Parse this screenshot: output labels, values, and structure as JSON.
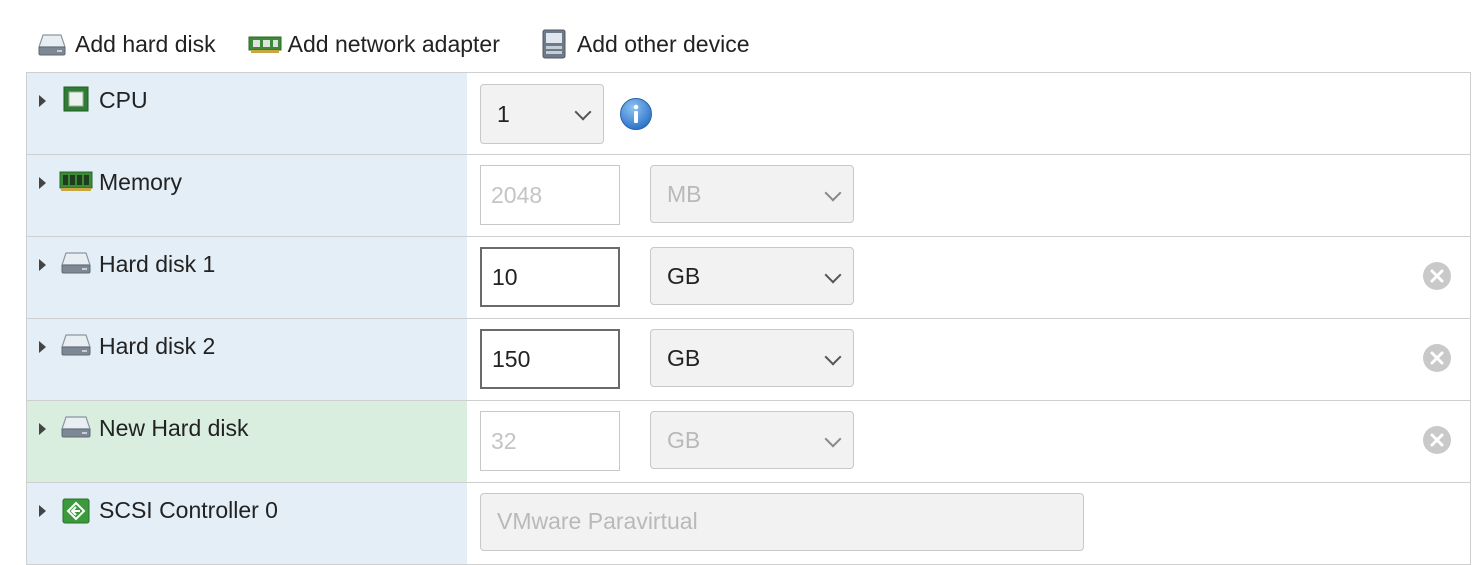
{
  "toolbar": {
    "add_hard_disk": "Add hard disk",
    "add_network_adapter": "Add network adapter",
    "add_other_device": "Add other device"
  },
  "rows": [
    {
      "label": "CPU",
      "icon": "cpu-icon",
      "select": "1"
    },
    {
      "label": "Memory",
      "icon": "memory-icon",
      "input": "2048",
      "unit": "MB",
      "disabled": true
    },
    {
      "label": "Hard disk 1",
      "icon": "hard-disk-icon",
      "input": "10",
      "unit": "GB"
    },
    {
      "label": "Hard disk 2",
      "icon": "hard-disk-icon",
      "input": "150",
      "unit": "GB"
    },
    {
      "label": "New Hard disk",
      "icon": "hard-disk-icon",
      "input": "32",
      "unit": "GB",
      "disabled": true,
      "new": true
    },
    {
      "label": "SCSI Controller 0",
      "icon": "scsi-controller-icon",
      "select": "VMware Paravirtual"
    }
  ],
  "colors": {
    "label_bg": "#e3eef7",
    "new_label_bg": "#d9eedf",
    "info_blue": "#3b82d6",
    "remove_gray": "#c9c9c9"
  }
}
